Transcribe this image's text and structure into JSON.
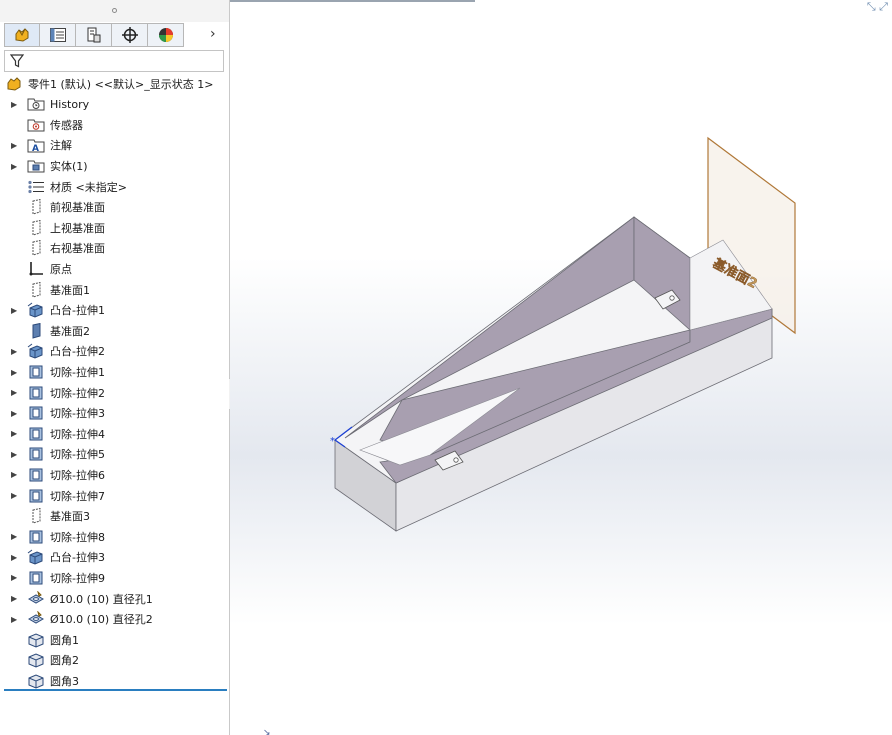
{
  "root": {
    "label": "零件1 (默认) <<默认>_显示状态 1>"
  },
  "tree_items": [
    {
      "label": "History",
      "icon": "history-folder-icon",
      "expandable": true
    },
    {
      "label": "传感器",
      "icon": "sensors-folder-icon",
      "expandable": false
    },
    {
      "label": "注解",
      "icon": "annotations-icon",
      "expandable": true
    },
    {
      "label": "实体(1)",
      "icon": "solid-bodies-icon",
      "expandable": true
    },
    {
      "label": "材质 <未指定>",
      "icon": "material-icon",
      "expandable": false
    },
    {
      "label": "前视基准面",
      "icon": "plane-icon",
      "expandable": false
    },
    {
      "label": "上视基准面",
      "icon": "plane-icon",
      "expandable": false
    },
    {
      "label": "右视基准面",
      "icon": "plane-icon",
      "expandable": false
    },
    {
      "label": "原点",
      "icon": "origin-icon",
      "expandable": false
    },
    {
      "label": "基准面1",
      "icon": "plane-icon",
      "expandable": false
    },
    {
      "label": "凸台-拉伸1",
      "icon": "boss-extrude-icon",
      "expandable": true
    },
    {
      "label": "基准面2",
      "icon": "plane-selected-icon",
      "expandable": false
    },
    {
      "label": "凸台-拉伸2",
      "icon": "boss-extrude-icon",
      "expandable": true
    },
    {
      "label": "切除-拉伸1",
      "icon": "cut-extrude-icon",
      "expandable": true
    },
    {
      "label": "切除-拉伸2",
      "icon": "cut-extrude-icon",
      "expandable": true
    },
    {
      "label": "切除-拉伸3",
      "icon": "cut-extrude-icon",
      "expandable": true
    },
    {
      "label": "切除-拉伸4",
      "icon": "cut-extrude-icon",
      "expandable": true
    },
    {
      "label": "切除-拉伸5",
      "icon": "cut-extrude-icon",
      "expandable": true
    },
    {
      "label": "切除-拉伸6",
      "icon": "cut-extrude-icon",
      "expandable": true
    },
    {
      "label": "切除-拉伸7",
      "icon": "cut-extrude-icon",
      "expandable": true
    },
    {
      "label": "基准面3",
      "icon": "plane-icon",
      "expandable": false
    },
    {
      "label": "切除-拉伸8",
      "icon": "cut-extrude-icon",
      "expandable": true
    },
    {
      "label": "凸台-拉伸3",
      "icon": "boss-extrude-icon",
      "expandable": true
    },
    {
      "label": "切除-拉伸9",
      "icon": "cut-extrude-icon",
      "expandable": true
    },
    {
      "label": "Ø10.0 (10) 直径孔1",
      "icon": "hole-wizard-icon",
      "expandable": true
    },
    {
      "label": "Ø10.0 (10) 直径孔2",
      "icon": "hole-wizard-icon",
      "expandable": true
    },
    {
      "label": "圆角1",
      "icon": "fillet-icon",
      "expandable": false
    },
    {
      "label": "圆角2",
      "icon": "fillet-icon",
      "expandable": false
    },
    {
      "label": "圆角3",
      "icon": "fillet-icon",
      "expandable": false
    }
  ],
  "viewport": {
    "plane_label": "基准面2",
    "colors": {
      "part_face": "#a89fb0",
      "part_light": "#c9c9cf",
      "plane_edge": "#b07838",
      "plane_fill": "#f6efe7",
      "label": "#9a6a3a"
    }
  }
}
